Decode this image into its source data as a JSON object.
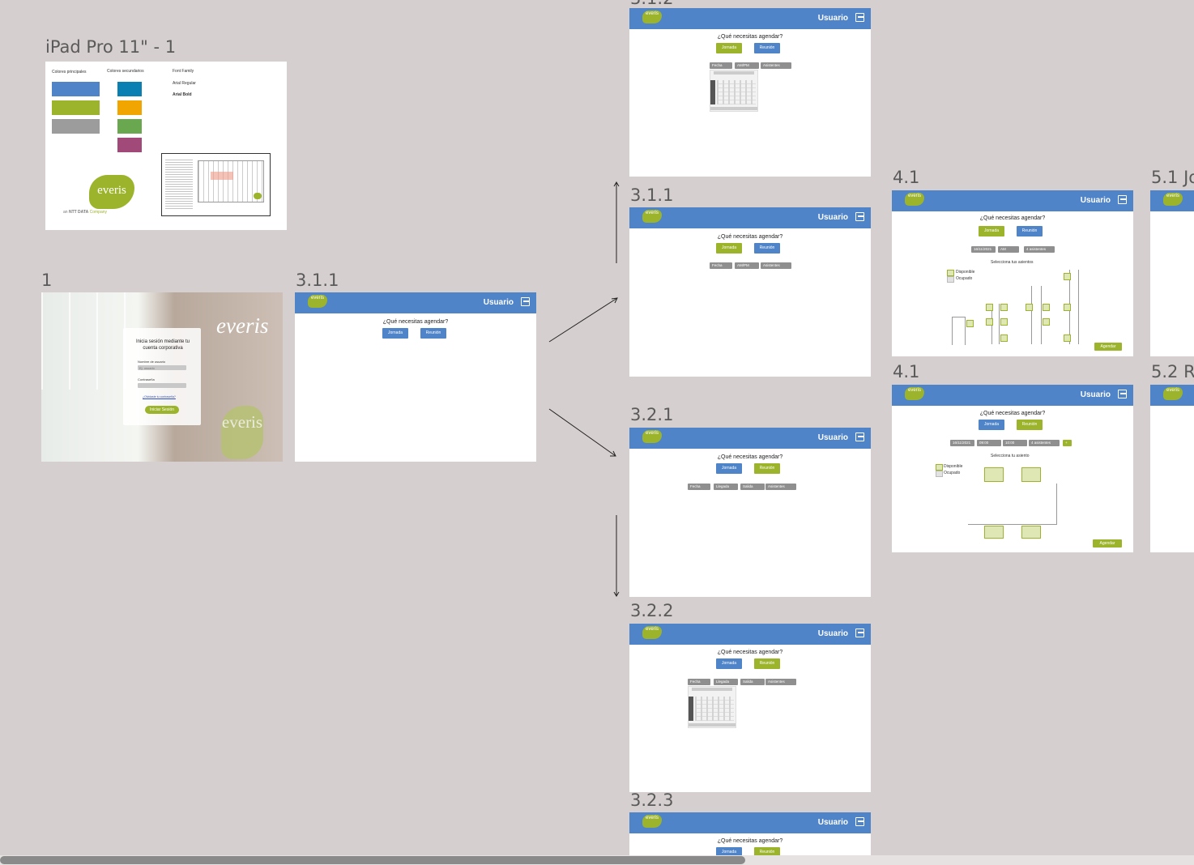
{
  "frames": {
    "style": {
      "label": "iPad Pro 11\" - 1",
      "principal": "Colores principales",
      "secondary": "Colores secundarios",
      "font_title": "Font Family",
      "font1": "Arial Regular",
      "font2": "Arial Bold",
      "brand_logo": "everis",
      "brand_sub1": "an ",
      "brand_sub2": "NTT DATA",
      "brand_sub3": " Company"
    },
    "login": {
      "label": "1",
      "wall_text": "everis",
      "title": "Inicia sesión mediante tu cuenta corporativa",
      "user_label": "Nombre de usuario",
      "user_placeholder": "Ej. usuario",
      "pass_label": "Contraseña",
      "pass_placeholder": "",
      "forgot": "¿Olvidaste tu contraseña?",
      "login_btn": "Iniciar Sesión",
      "logo2": "everis"
    },
    "f311a": {
      "label": "3.1.1"
    },
    "f312": {
      "label": "3.1.2"
    },
    "f311b": {
      "label": "3.1.1"
    },
    "f321": {
      "label": "3.2.1"
    },
    "f322": {
      "label": "3.2.2"
    },
    "f323": {
      "label": "3.2.3"
    },
    "f41a": {
      "label": "4.1"
    },
    "f41b": {
      "label": "4.1"
    },
    "f51": {
      "label": "5.1 Jo"
    },
    "f52": {
      "label": "5.2 R"
    }
  },
  "common": {
    "user": "Usuario",
    "logo": "everis",
    "question": "¿Qué necesitas agendar?",
    "jornada": "Jornada",
    "reunion": "Reunión",
    "fecha": "Fecha",
    "ampm": "AM/PM",
    "asistentes": "Asistentes",
    "llegada": "Llegada",
    "salida": "Salida",
    "select_seats": "Selecciona tus asientos",
    "select_seat": "Selecciona tu asiento",
    "disponible": "Disponible",
    "ocupado": "Ocupado",
    "agendar": "Agendar",
    "f41a_chips": [
      "16/11/2021",
      "AM",
      "4 asistentes"
    ],
    "f41b_chips": [
      "16/11/2021",
      "09:00",
      "10:00",
      "4 asistentes"
    ],
    "f41b_plus": "+"
  },
  "colors": {
    "primary_blue": "#4f84c8",
    "primary_green": "#9cb42b",
    "primary_gray": "#9c9c9c",
    "sec_teal": "#0a7fb1",
    "sec_orange": "#f0a500",
    "sec_green": "#6aa84f",
    "sec_magenta": "#a14a7a",
    "canvas": "#d6cfcf"
  }
}
